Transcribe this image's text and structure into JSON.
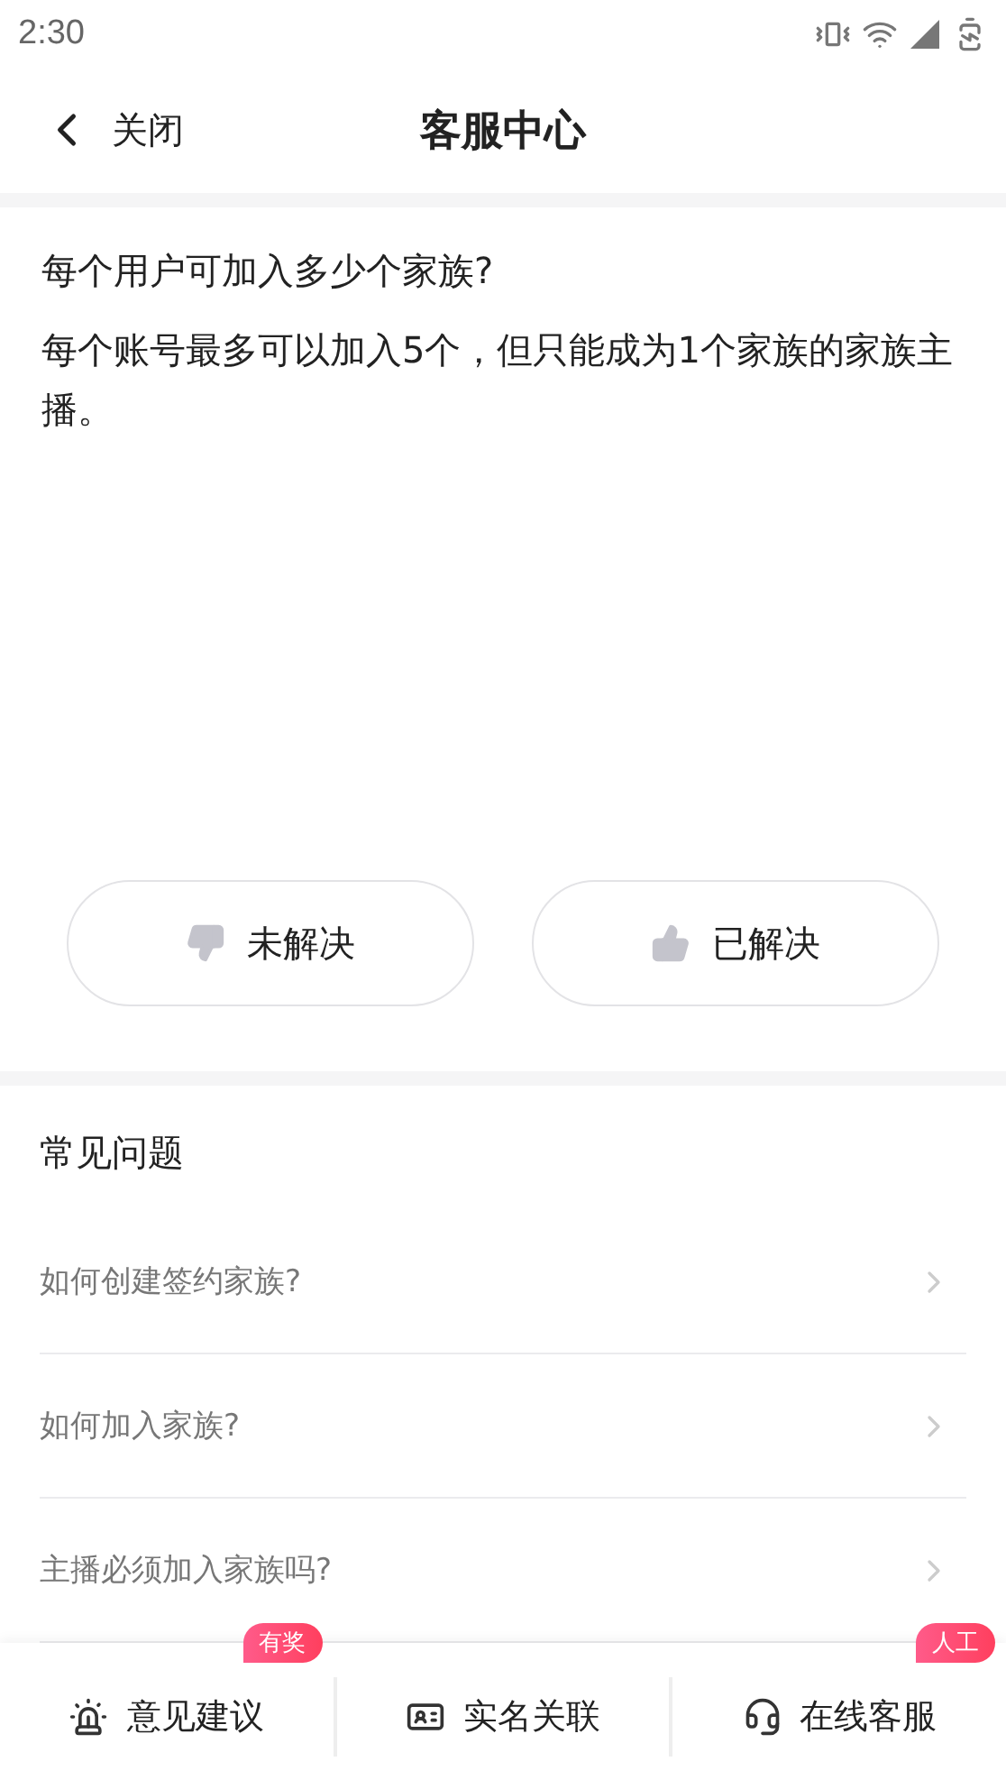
{
  "status_bar": {
    "time": "2:30"
  },
  "header": {
    "back_label": "关闭",
    "title": "客服中心"
  },
  "question": {
    "title": "每个用户可加入多少个家族?",
    "answer": "每个账号最多可以加入5个，但只能成为1个家族的家族主播。"
  },
  "feedback": [
    {
      "kind": "down",
      "label": "未解决"
    },
    {
      "kind": "up",
      "label": "已解决"
    }
  ],
  "faq": {
    "title": "常见问题",
    "items": [
      {
        "label": "如何创建签约家族?"
      },
      {
        "label": "如何加入家族?"
      },
      {
        "label": "主播必须加入家族吗?"
      }
    ]
  },
  "bottom_bar": [
    {
      "kind": "feedback",
      "label": "意见建议",
      "badge": "有奖"
    },
    {
      "kind": "idcard",
      "label": "实名关联"
    },
    {
      "kind": "service",
      "label": "在线客服",
      "badge": "人工"
    }
  ]
}
